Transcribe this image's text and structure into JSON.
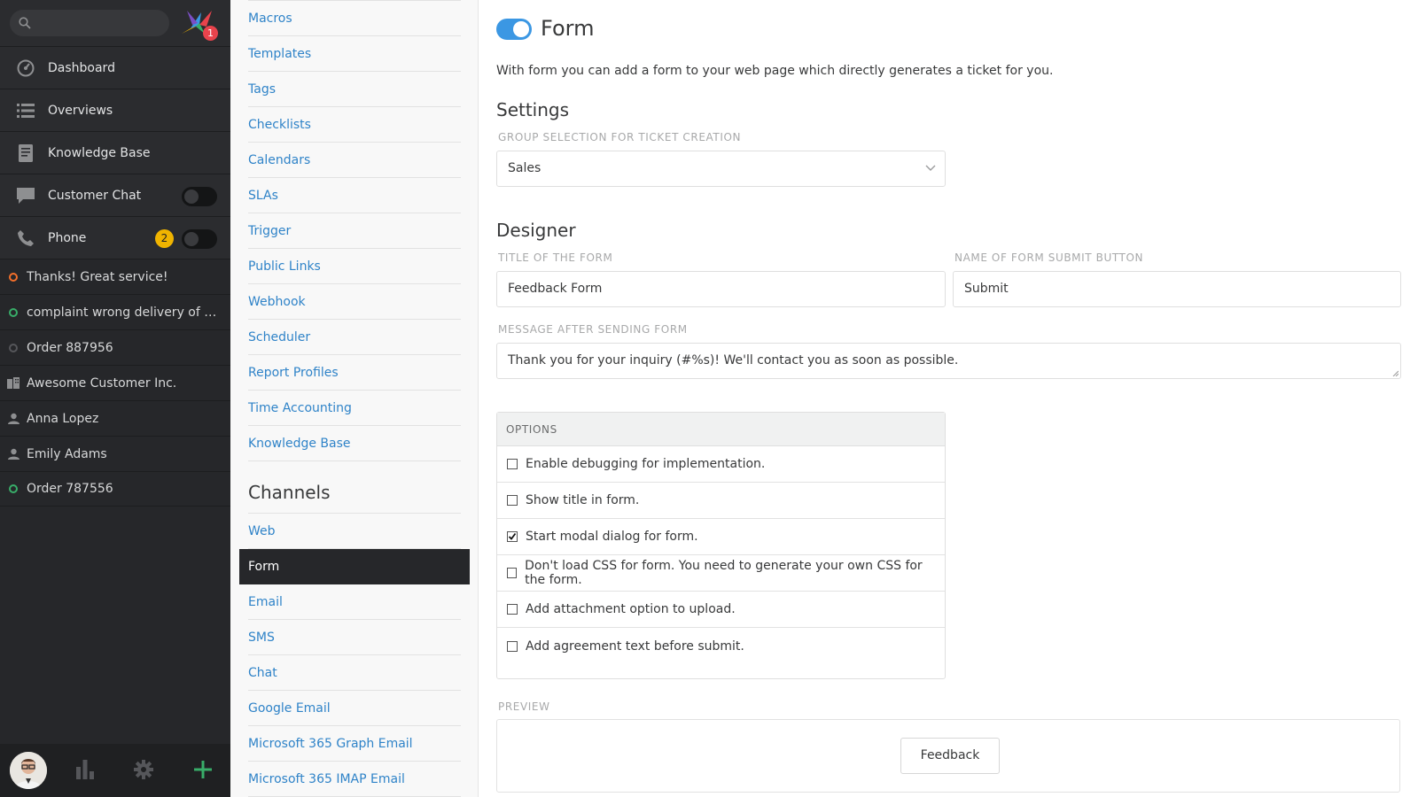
{
  "nav": {
    "search": {
      "placeholder": ""
    },
    "notification_count": "1",
    "items": [
      {
        "label": "Dashboard",
        "icon": "dashboard-icon"
      },
      {
        "label": "Overviews",
        "icon": "overviews-icon"
      },
      {
        "label": "Knowledge Base",
        "icon": "knowledge-base-icon"
      },
      {
        "label": "Customer Chat",
        "icon": "chat-icon",
        "toggle": false
      },
      {
        "label": "Phone",
        "icon": "phone-icon",
        "badge": "2",
        "toggle": false
      }
    ],
    "tasks": [
      {
        "label": "Thanks! Great service!",
        "icon": "ticket-status-icon",
        "color": "#f36f2a"
      },
      {
        "label": "complaint wrong delivery of ord...",
        "icon": "ticket-status-icon",
        "color": "#38ad69"
      },
      {
        "label": "Order 887956",
        "icon": "ticket-status-icon",
        "color": "#6a6b6d"
      },
      {
        "label": "Awesome Customer Inc.",
        "icon": "organization-icon"
      },
      {
        "label": "Anna Lopez",
        "icon": "user-icon"
      },
      {
        "label": "Emily Adams",
        "icon": "user-icon"
      },
      {
        "label": "Order 787556",
        "icon": "ticket-status-icon",
        "color": "#38ad69"
      }
    ],
    "bottom_icons": [
      "avatar",
      "reporting-icon",
      "settings-icon",
      "add-icon"
    ]
  },
  "menu": {
    "links": [
      "Macros",
      "Templates",
      "Tags",
      "Checklists",
      "Calendars",
      "SLAs",
      "Trigger",
      "Public Links",
      "Webhook",
      "Scheduler",
      "Report Profiles",
      "Time Accounting",
      "Knowledge Base"
    ],
    "channels_heading": "Channels",
    "channels": [
      "Web",
      "Form",
      "Email",
      "SMS",
      "Chat",
      "Google Email",
      "Microsoft 365 Graph Email",
      "Microsoft 365 IMAP Email"
    ],
    "active_channel": "Form"
  },
  "main": {
    "title": "Form",
    "enabled": true,
    "description": "With form you can add a form to your web page which directly generates a ticket for you.",
    "settings_title": "Settings",
    "group_label": "Group selection for Ticket creation",
    "group_value": "Sales",
    "designer_title": "Designer",
    "title_label": "Title of the form",
    "title_value": "Feedback Form",
    "submit_label": "Name of form submit button",
    "submit_value": "Submit",
    "message_label": "Message after sending form",
    "message_value": "Thank you for your inquiry (#%s)! We'll contact you as soon as possible.",
    "options_header": "OPTIONS",
    "options": [
      {
        "label": "Enable debugging for implementation.",
        "checked": false
      },
      {
        "label": "Show title in form.",
        "checked": false
      },
      {
        "label": "Start modal dialog for form.",
        "checked": true
      },
      {
        "label": "Don't load CSS for form. You need to generate your own CSS for the form.",
        "checked": false
      },
      {
        "label": "Add attachment option to upload.",
        "checked": false
      },
      {
        "label": "Add agreement text before submit.",
        "checked": false
      }
    ],
    "preview_label": "Preview",
    "preview_button": "Feedback"
  },
  "colors": {
    "accent": "#3b97e3",
    "link": "#2f83c8",
    "nav_bg": "#26272a",
    "badge": "#f0b400",
    "notification": "#e8434c"
  }
}
